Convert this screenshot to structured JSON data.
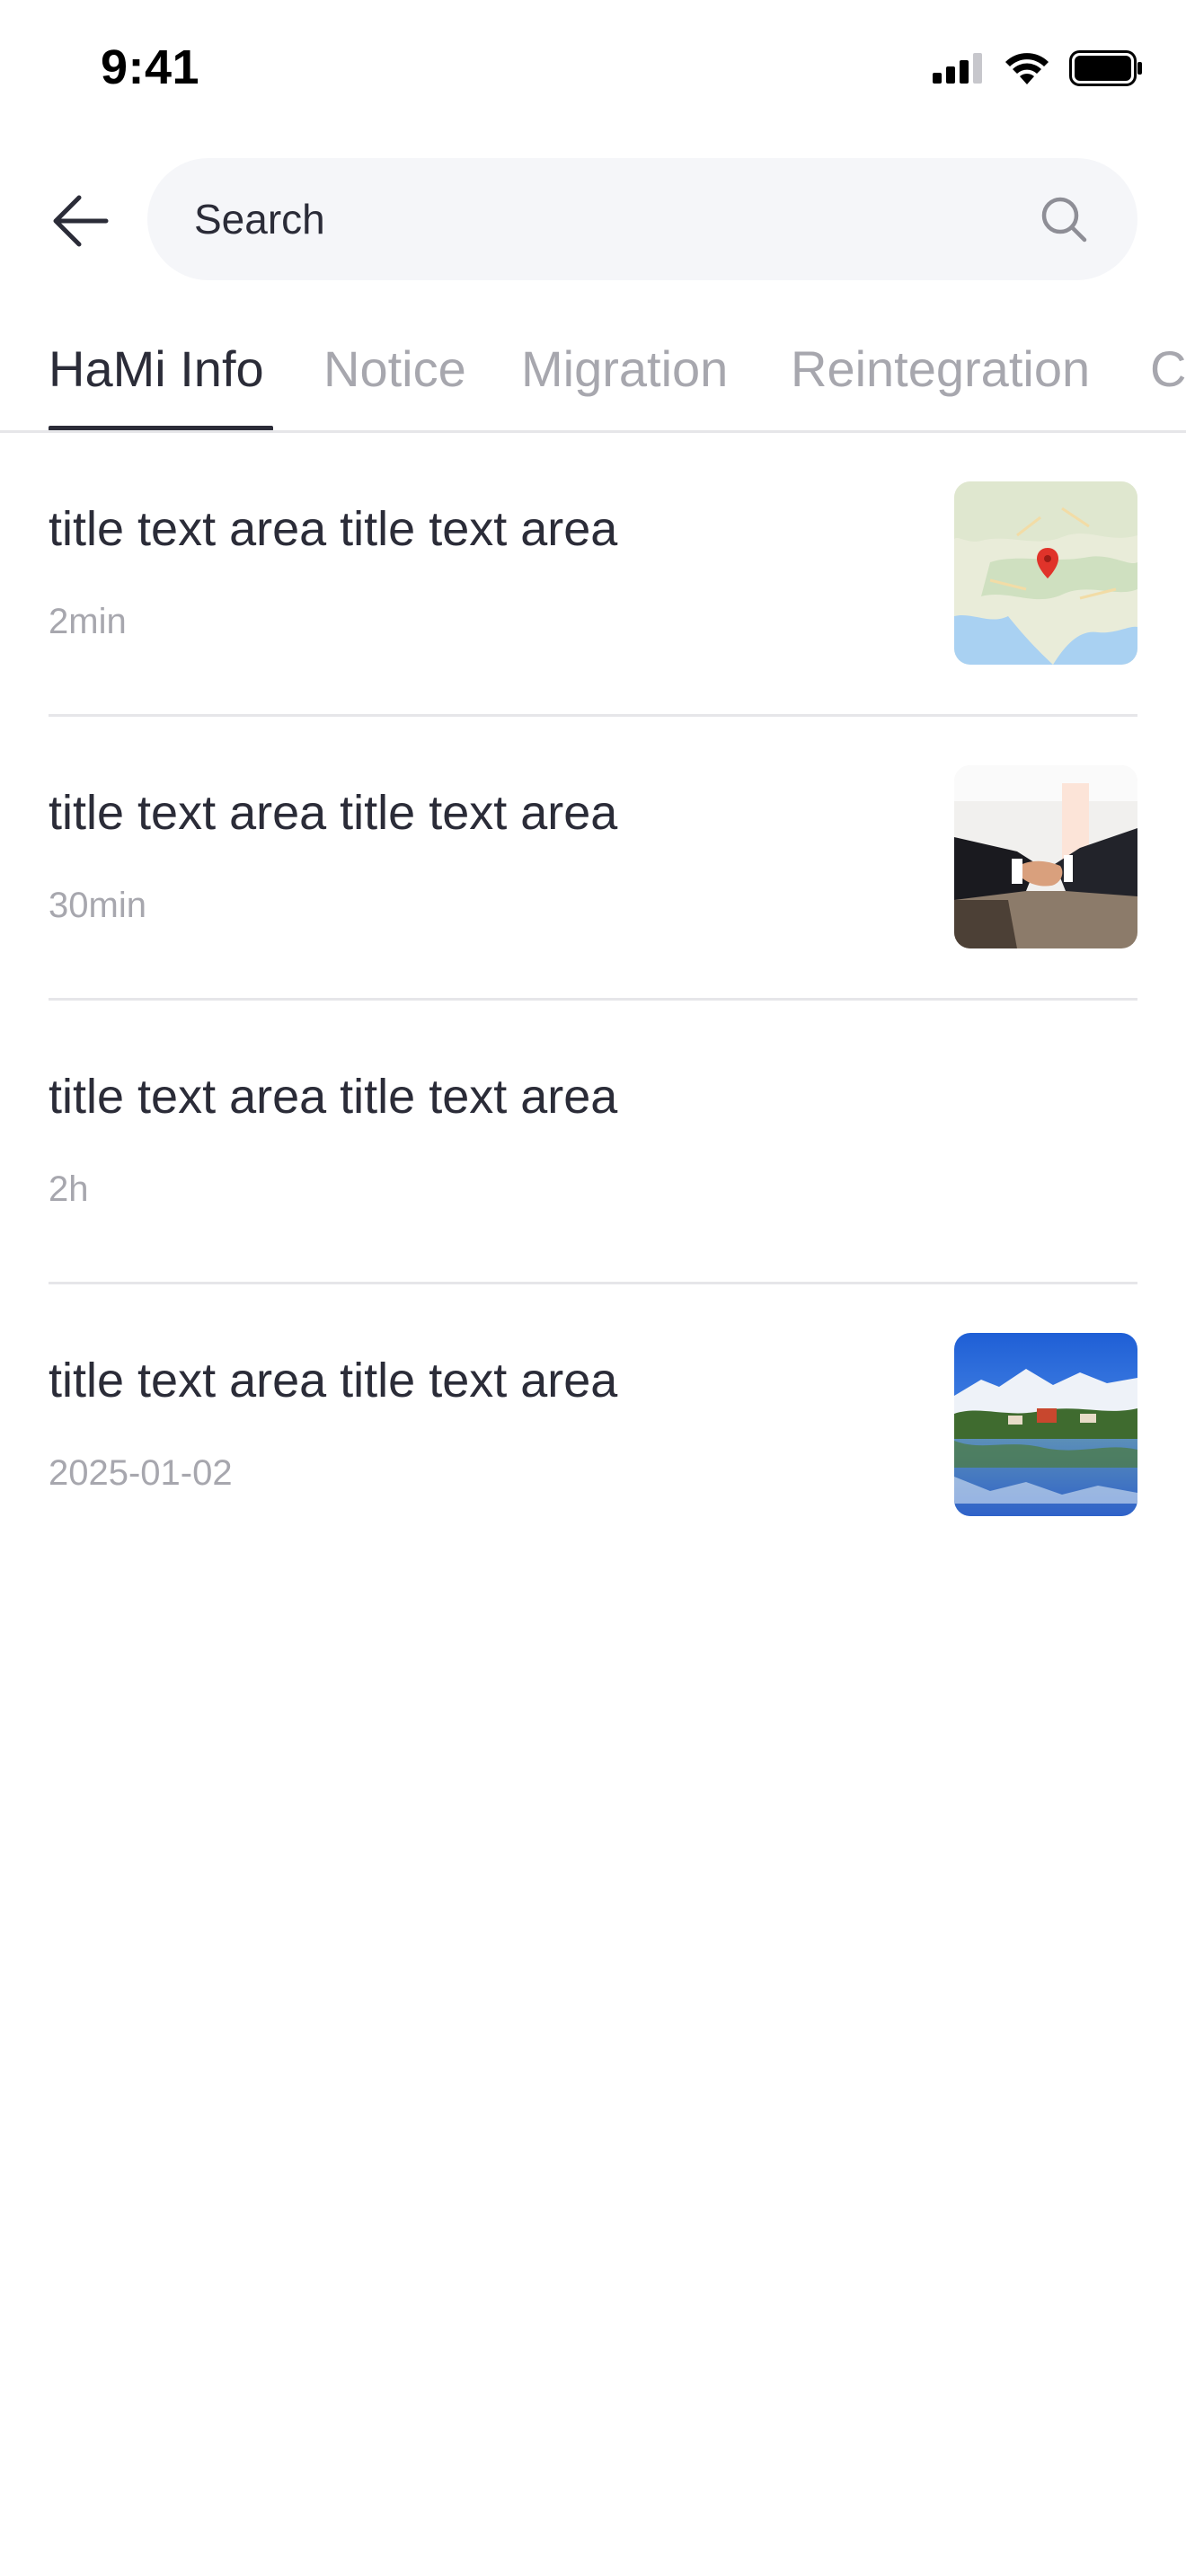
{
  "status_bar": {
    "time": "9:41"
  },
  "search": {
    "placeholder": "Search",
    "value": ""
  },
  "tabs": [
    {
      "label": "HaMi Info",
      "active": true
    },
    {
      "label": "Notice",
      "active": false
    },
    {
      "label": "Migration",
      "active": false
    },
    {
      "label": "Reintegration",
      "active": false
    },
    {
      "label": "Co",
      "active": false
    }
  ],
  "items": [
    {
      "title": "title text area title text area",
      "time": "2min",
      "thumbnail": "map-thumbnail"
    },
    {
      "title": "title text area title text area",
      "time": "30min",
      "thumbnail": "handshake-thumbnail"
    },
    {
      "title": "title text area title text area",
      "time": "2h",
      "thumbnail": null
    },
    {
      "title": "title text area title text area",
      "time": "2025-01-02",
      "thumbnail": "lake-mountain-thumbnail"
    }
  ],
  "colors": {
    "text": "#2b2c38",
    "muted": "#a7a7ae",
    "search_bg": "#f5f6f9",
    "divider": "#e6e6e9"
  }
}
